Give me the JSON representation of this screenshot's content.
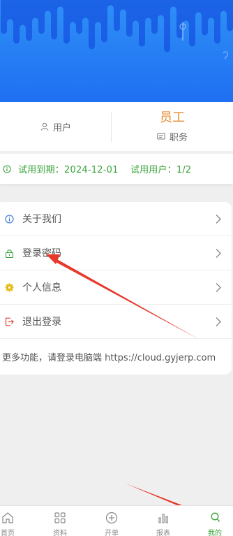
{
  "user": {
    "username_label": "用户",
    "role": "员工",
    "role_label": "职务"
  },
  "trial": {
    "text": "试用到期：2024-12-01    试用用户：1/2"
  },
  "menu": {
    "items": [
      {
        "label": "关于我们",
        "icon": "info-icon"
      },
      {
        "label": "登录密码",
        "icon": "lock-icon"
      },
      {
        "label": "个人信息",
        "icon": "gear-icon"
      },
      {
        "label": "退出登录",
        "icon": "logout-icon"
      }
    ],
    "more": "更多功能，请登录电脑端 https://cloud.gyjerp.com"
  },
  "tabs": [
    {
      "label": "首页",
      "icon": "home-icon"
    },
    {
      "label": "资料",
      "icon": "grid-icon"
    },
    {
      "label": "开单",
      "icon": "plus-circle-icon"
    },
    {
      "label": "报表",
      "icon": "bar-chart-icon"
    },
    {
      "label": "我的",
      "icon": "user-icon",
      "active": true
    }
  ],
  "colors": {
    "header_blue": "#1f6ff2",
    "role_orange": "#e6892e",
    "green": "#3aa33a",
    "arrow_red": "#e8382a"
  }
}
